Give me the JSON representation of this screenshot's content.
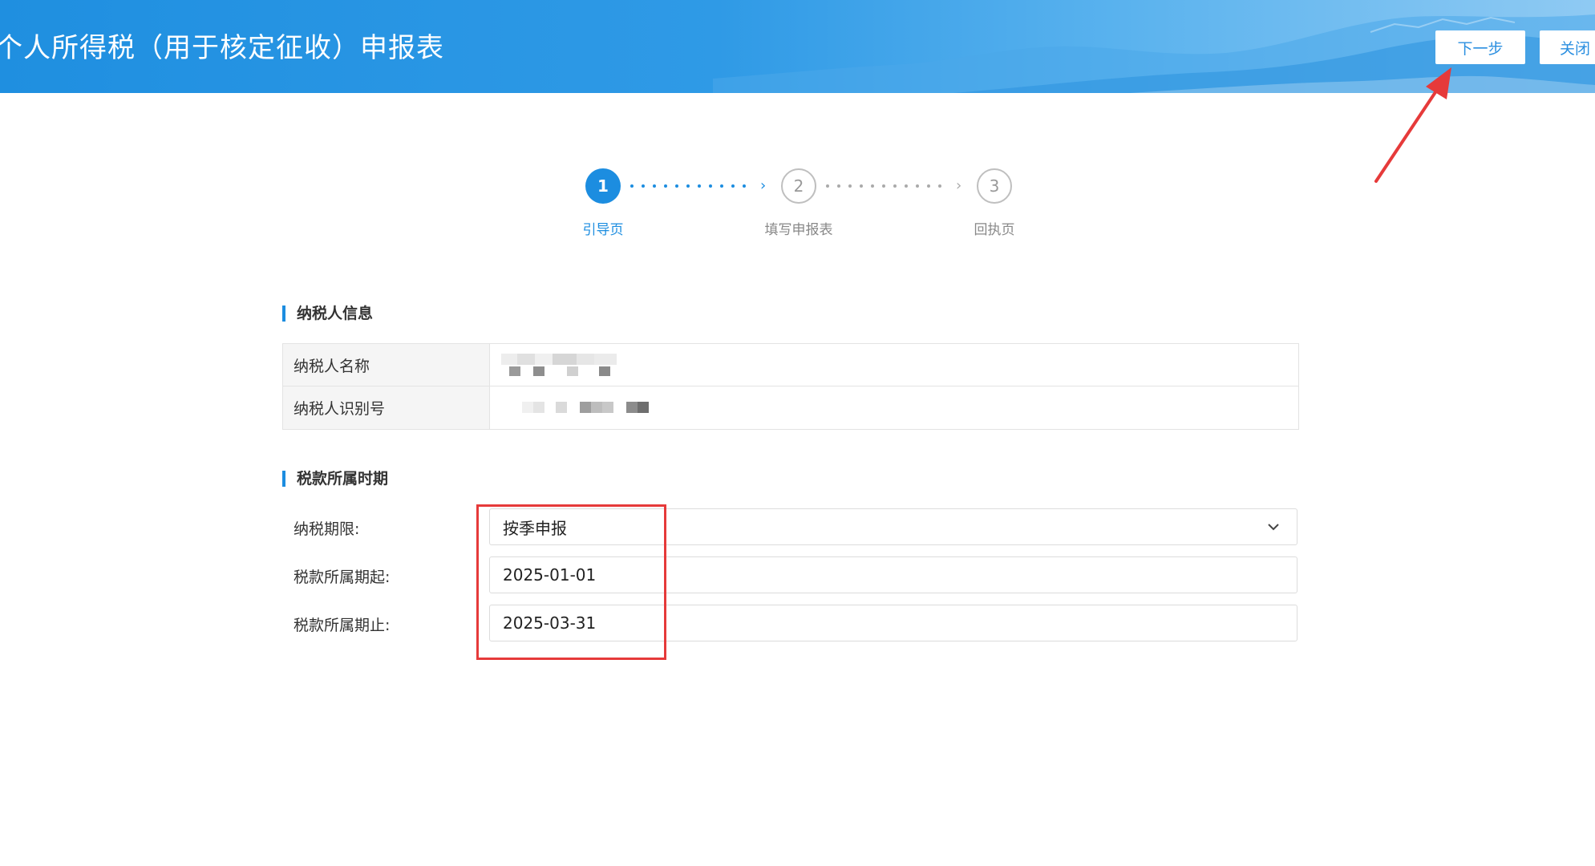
{
  "header": {
    "title": "个人所得税（用于核定征收）申报表",
    "next_label": "下一步",
    "close_label": "关闭"
  },
  "steps": [
    {
      "number": "1",
      "label": "引导页",
      "state": "active"
    },
    {
      "number": "2",
      "label": "填写申报表",
      "state": "todo"
    },
    {
      "number": "3",
      "label": "回执页",
      "state": "todo"
    }
  ],
  "taxpayer_section": {
    "title": "纳税人信息",
    "rows": [
      {
        "label": "纳税人名称"
      },
      {
        "label": "纳税人识别号"
      }
    ]
  },
  "period_section": {
    "title": "税款所属时期",
    "filing_term": {
      "label": "纳税期限:",
      "value": "按季申报"
    },
    "period_start": {
      "label": "税款所属期起:",
      "value": "2025-01-01"
    },
    "period_end": {
      "label": "税款所属期止:",
      "value": "2025-03-31"
    }
  },
  "colors": {
    "accent": "#1c8de0",
    "annotation": "#e63a3a"
  }
}
